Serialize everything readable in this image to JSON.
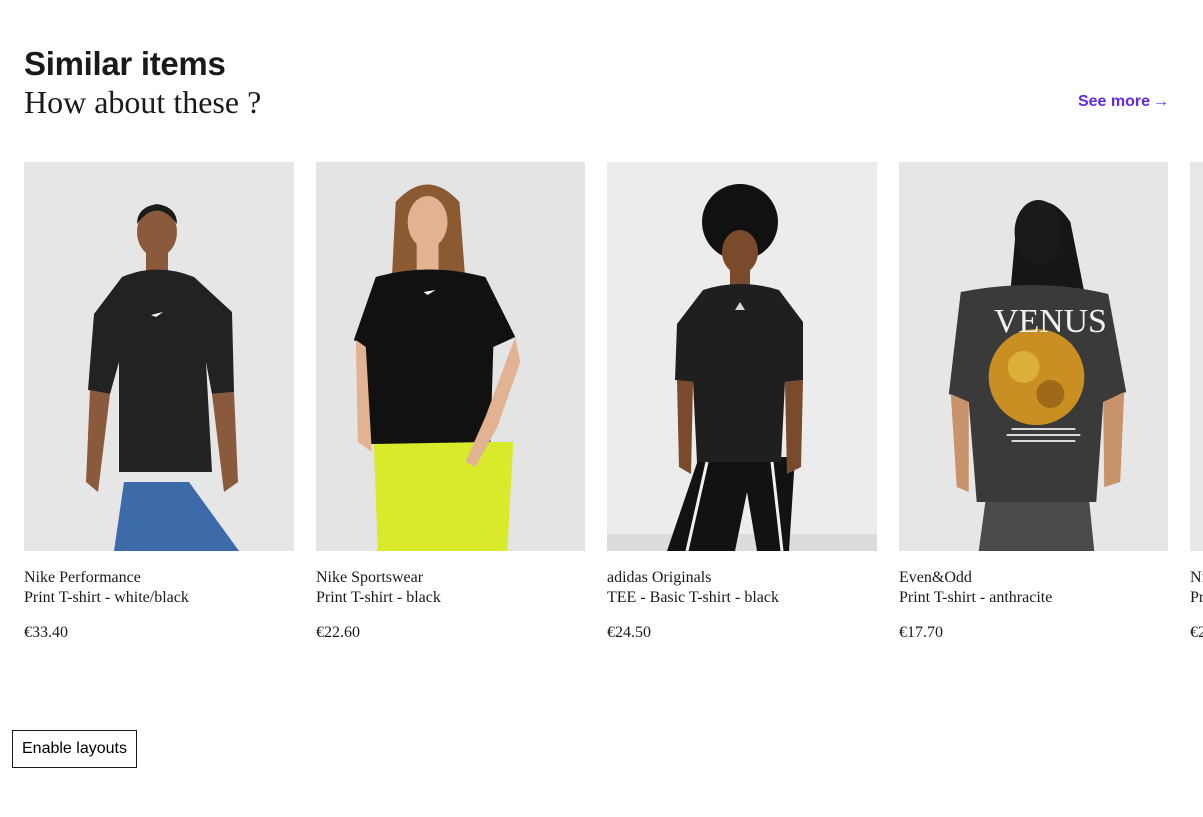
{
  "section": {
    "title": "Similar items",
    "subtitle": "How about these ?",
    "see_more_label": "See more",
    "see_more_arrow": "→",
    "accent_color": "#6329e8"
  },
  "products": [
    {
      "brand": "Nike Performance",
      "name": "Print T-shirt - white/black",
      "price": "€33.40",
      "pants_color": "#3d6aa8"
    },
    {
      "brand": "Nike Sportswear",
      "name": "Print T-shirt - black",
      "price": "€22.60",
      "pants_color": "#d9ea2a"
    },
    {
      "brand": "adidas Originals",
      "name": "TEE - Basic T-shirt - black",
      "price": "€24.50",
      "pants_color": "#111111"
    },
    {
      "brand": "Even&Odd",
      "name": "Print T-shirt - anthracite",
      "price": "€17.70",
      "pants_color": "#4a4a4a",
      "print_text": "VENUS"
    },
    {
      "brand": "Ni",
      "name": "Pr",
      "price": "€2"
    }
  ],
  "footer": {
    "enable_layouts_label": "Enable layouts"
  }
}
